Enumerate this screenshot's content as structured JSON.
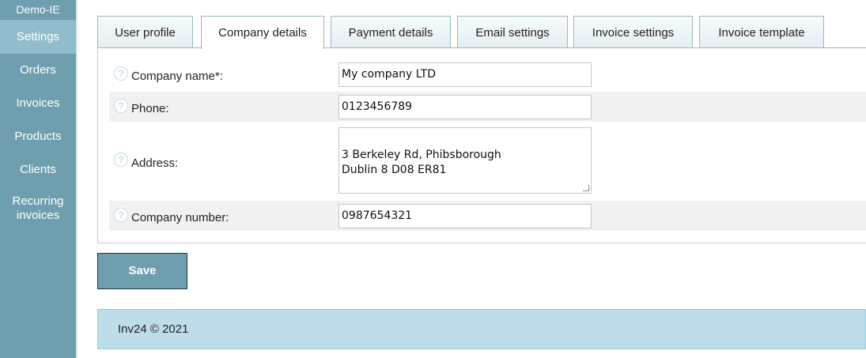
{
  "sidebar": {
    "brand": "Demo-IE",
    "items": [
      {
        "label": "Settings",
        "active": true
      },
      {
        "label": "Orders"
      },
      {
        "label": "Invoices"
      },
      {
        "label": "Products"
      },
      {
        "label": "Clients"
      },
      {
        "label": "Recurring invoices"
      }
    ]
  },
  "tabs": [
    {
      "label": "User profile"
    },
    {
      "label": "Company details",
      "active": true
    },
    {
      "label": "Payment details"
    },
    {
      "label": "Email settings"
    },
    {
      "label": "Invoice settings"
    },
    {
      "label": "Invoice template"
    }
  ],
  "form": {
    "company_name": {
      "label": "Company name*:",
      "value": "My company LTD"
    },
    "phone": {
      "label": "Phone:",
      "value": "0123456789"
    },
    "address": {
      "label": "Address:",
      "value": "3 Berkeley Rd, Phibsborough\nDublin 8 D08 ER81"
    },
    "company_number": {
      "label": "Company number:",
      "value": "0987654321"
    }
  },
  "save_label": "Save",
  "footer": "Inv24 © 2021",
  "colors": {
    "sidebar": "#6f9eaf",
    "active_nav": "#90bccb",
    "footer": "#bddde8",
    "button": "#6f9eaf"
  },
  "icons": {
    "help": "help-circle-icon"
  }
}
